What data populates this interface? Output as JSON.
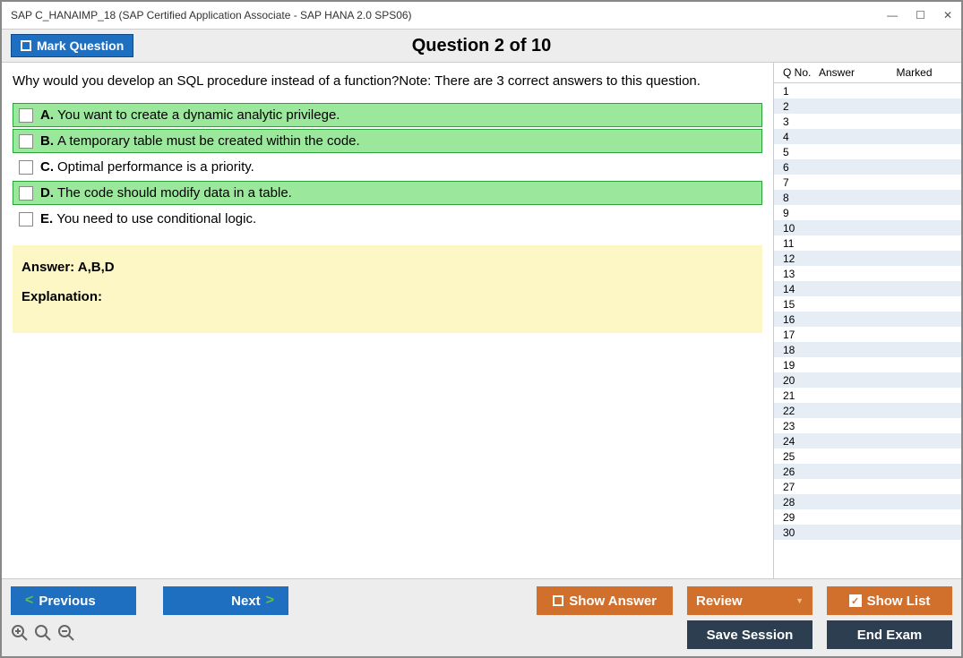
{
  "window": {
    "title": "SAP C_HANAIMP_18 (SAP Certified Application Associate - SAP HANA 2.0 SPS06)"
  },
  "toolbar": {
    "mark_label": "Mark Question",
    "question_header": "Question 2 of 10"
  },
  "question": {
    "text": "Why would you develop an SQL procedure instead of a function?Note: There are 3 correct answers to this question.",
    "options": [
      {
        "letter": "A.",
        "text": "You want to create a dynamic analytic privilege.",
        "correct": true
      },
      {
        "letter": "B.",
        "text": "A temporary table must be created within the code.",
        "correct": true
      },
      {
        "letter": "C.",
        "text": "Optimal performance is a priority.",
        "correct": false
      },
      {
        "letter": "D.",
        "text": "The code should modify data in a table.",
        "correct": true
      },
      {
        "letter": "E.",
        "text": "You need to use conditional logic.",
        "correct": false
      }
    ],
    "answer_label": "Answer: A,B,D",
    "explanation_label": "Explanation:"
  },
  "sidebar": {
    "headers": {
      "qno": "Q No.",
      "answer": "Answer",
      "marked": "Marked"
    },
    "total_rows": 30
  },
  "footer": {
    "previous": "Previous",
    "next": "Next",
    "show_answer": "Show Answer",
    "review": "Review",
    "show_list": "Show List",
    "save_session": "Save Session",
    "end_exam": "End Exam"
  }
}
